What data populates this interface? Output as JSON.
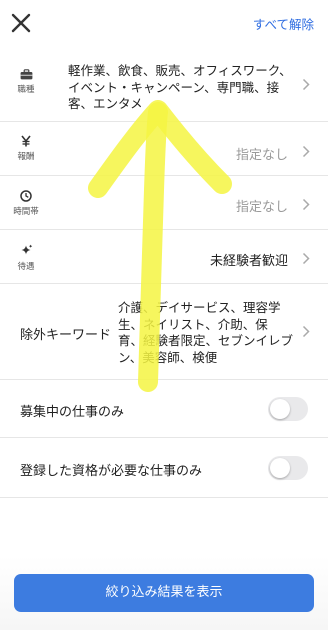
{
  "header": {
    "clear_all_label": "すべて解除"
  },
  "filters": {
    "job_type": {
      "icon_label": "職種",
      "icon": "briefcase-icon",
      "lines": [
        "軽作業、飲食、販売、オフィスワーク、",
        "イベント・キャンペーン、専門職、接",
        "客、エンタメ"
      ]
    },
    "pay": {
      "icon_label": "報酬",
      "icon": "yen-icon",
      "value": "指定なし"
    },
    "time_slot": {
      "icon_label": "時間帯",
      "icon": "clock-icon",
      "value": "指定なし"
    },
    "benefits": {
      "icon_label": "待遇",
      "icon": "sparkle-icon",
      "value": "未経験者歓迎"
    },
    "exclude_keywords": {
      "label": "除外キーワード",
      "lines": [
        "介護、デイサービス、理容学",
        "生、ネイリスト、介助、保",
        "育、経験者限定、セブンイレブ",
        "ン、美容師、検便"
      ]
    }
  },
  "toggles": {
    "recruiting_only": {
      "label": "募集中の仕事のみ",
      "on": false
    },
    "qualified_only": {
      "label": "登録した資格が必要な仕事のみ",
      "on": false
    }
  },
  "footer": {
    "submit_label": "絞り込み結果を表示"
  },
  "colors": {
    "accent": "#2f6de1",
    "button": "#3d7ce0",
    "marker": "#f5f542"
  }
}
